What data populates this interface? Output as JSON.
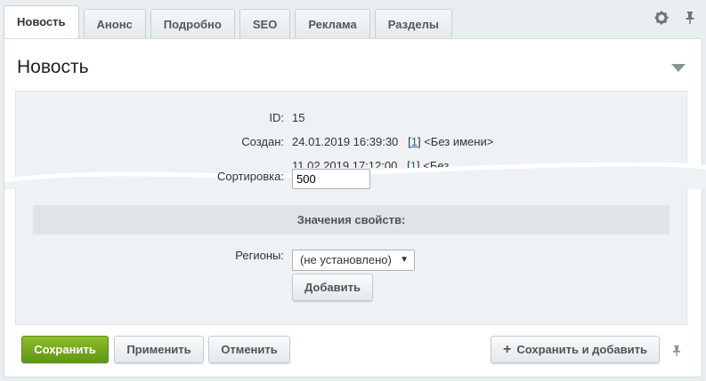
{
  "tabs": [
    {
      "label": "Новость",
      "active": true
    },
    {
      "label": "Анонс"
    },
    {
      "label": "Подробно"
    },
    {
      "label": "SEO"
    },
    {
      "label": "Реклама"
    },
    {
      "label": "Разделы"
    }
  ],
  "tab_icons": [
    "gear-icon",
    "pin-icon"
  ],
  "panel": {
    "title": "Новость",
    "fields": {
      "id_label": "ID:",
      "id_value": "15",
      "created_label": "Создан:",
      "created_value": "24.01.2019 16:39:30",
      "created_user_link": "1",
      "created_user_name": "<Без имени>",
      "modified_value_partial": "11.02.2019 17:12:00",
      "modified_user_link_partial": "1",
      "modified_user_name_partial": "<Без",
      "sort_label": "Сортировка:",
      "sort_value": "500"
    },
    "section_title": "Значения свойств:",
    "regions_label": "Регионы:",
    "regions_selected": "(не установлено)",
    "add_button": "Добавить"
  },
  "footer": {
    "save": "Сохранить",
    "apply": "Применить",
    "cancel": "Отменить",
    "save_and_add": "Сохранить и добавить"
  },
  "colors": {
    "save_button": "#6fa61f",
    "link": "#2067b0",
    "background": "#e9eef0"
  }
}
